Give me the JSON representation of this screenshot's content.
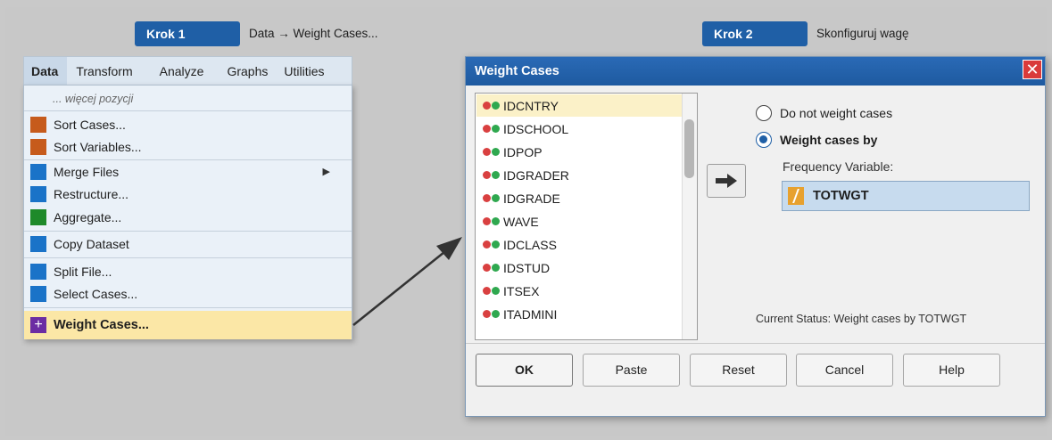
{
  "steps": [
    {
      "badge": "Krok 1",
      "text": "Data → Weight Cases..."
    },
    {
      "badge": "Krok 2",
      "text": "Skonfiguruj wagę"
    }
  ],
  "menubar": {
    "items": [
      "Data",
      "Transform",
      "Analyze",
      "Graphs",
      "Utilities"
    ],
    "active": "Data"
  },
  "dropdown": {
    "more_label": "... więcej pozycji",
    "items": [
      {
        "label": "Sort Cases...",
        "icon_color": "#c65b1c"
      },
      {
        "label": "Sort Variables...",
        "icon_color": "#c65b1c"
      },
      {
        "label": "Merge Files",
        "icon_color": "#1a73c8",
        "submenu": true
      },
      {
        "label": "Restructure...",
        "icon_color": "#1a73c8"
      },
      {
        "label": "Aggregate...",
        "icon_color": "#1e8a2a"
      },
      {
        "label": "Copy Dataset",
        "icon_color": "#1a73c8"
      },
      {
        "label": "Split File...",
        "icon_color": "#1a73c8"
      },
      {
        "label": "Select Cases...",
        "icon_color": "#1a73c8"
      }
    ],
    "highlighted": {
      "label": "Weight Cases...",
      "icon": "plus-icon",
      "icon_color": "#6b2da3"
    }
  },
  "dialog": {
    "title": "Weight Cases",
    "variables": [
      "IDCNTRY",
      "IDSCHOOL",
      "IDPOP",
      "IDGRADER",
      "IDGRADE",
      "WAVE",
      "IDCLASS",
      "IDSTUD",
      "ITSEX",
      "ITADMINI"
    ],
    "selected_variable": "IDCNTRY",
    "options": {
      "no_weight": "Do not weight cases",
      "weight_by": "Weight cases by",
      "selected": "weight_by"
    },
    "frequency_label": "Frequency Variable:",
    "frequency_value": "TOTWGT",
    "status": "Current Status: Weight cases by TOTWGT",
    "buttons": {
      "ok": "OK",
      "paste": "Paste",
      "reset": "Reset",
      "cancel": "Cancel",
      "help": "Help"
    }
  },
  "colors": {
    "badge": "#1f5fa6",
    "titlebar": "#1f5fa6",
    "highlight": "#fbe7a6",
    "frequency_box": "#c7dbee",
    "close_button": "#d93a3a"
  }
}
